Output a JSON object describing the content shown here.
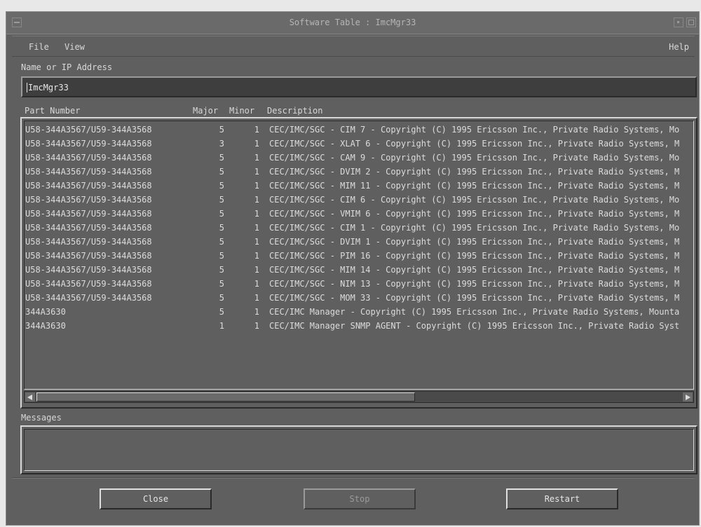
{
  "window": {
    "title": "Software Table : ImcMgr33"
  },
  "menubar": {
    "file": "File",
    "view": "View",
    "help": "Help"
  },
  "name_field": {
    "label": "Name or IP Address",
    "value": "ImcMgr33"
  },
  "table": {
    "columns": {
      "part": "Part Number",
      "major": "Major",
      "minor": "Minor",
      "description": "Description"
    },
    "rows": [
      {
        "part": "U58-344A3567/U59-344A3568",
        "major": "5",
        "minor": "1",
        "description": "CEC/IMC/SGC - CIM 7 - Copyright (C) 1995 Ericsson Inc., Private Radio Systems, Mo"
      },
      {
        "part": "U58-344A3567/U59-344A3568",
        "major": "3",
        "minor": "1",
        "description": "CEC/IMC/SGC - XLAT 6 - Copyright (C) 1995 Ericsson Inc., Private Radio Systems, M"
      },
      {
        "part": "U58-344A3567/U59-344A3568",
        "major": "5",
        "minor": "1",
        "description": "CEC/IMC/SGC - CAM 9 - Copyright (C) 1995 Ericsson Inc., Private Radio Systems, Mo"
      },
      {
        "part": "U58-344A3567/U59-344A3568",
        "major": "5",
        "minor": "1",
        "description": "CEC/IMC/SGC - DVIM 2 - Copyright (C) 1995 Ericsson Inc., Private Radio Systems, M"
      },
      {
        "part": "U58-344A3567/U59-344A3568",
        "major": "5",
        "minor": "1",
        "description": "CEC/IMC/SGC - MIM 11 - Copyright (C) 1995 Ericsson Inc., Private Radio Systems, M"
      },
      {
        "part": "U58-344A3567/U59-344A3568",
        "major": "5",
        "minor": "1",
        "description": "CEC/IMC/SGC - CIM 6 - Copyright (C) 1995 Ericsson Inc., Private Radio Systems, Mo"
      },
      {
        "part": "U58-344A3567/U59-344A3568",
        "major": "5",
        "minor": "1",
        "description": "CEC/IMC/SGC - VMIM 6 - Copyright (C) 1995 Ericsson Inc., Private Radio Systems, M"
      },
      {
        "part": "U58-344A3567/U59-344A3568",
        "major": "5",
        "minor": "1",
        "description": "CEC/IMC/SGC - CIM 1 - Copyright (C) 1995 Ericsson Inc., Private Radio Systems, Mo"
      },
      {
        "part": "U58-344A3567/U59-344A3568",
        "major": "5",
        "minor": "1",
        "description": "CEC/IMC/SGC - DVIM 1 - Copyright (C) 1995 Ericsson Inc., Private Radio Systems, M"
      },
      {
        "part": "U58-344A3567/U59-344A3568",
        "major": "5",
        "minor": "1",
        "description": "CEC/IMC/SGC - PIM 16 - Copyright (C) 1995 Ericsson Inc., Private Radio Systems, M"
      },
      {
        "part": "U58-344A3567/U59-344A3568",
        "major": "5",
        "minor": "1",
        "description": "CEC/IMC/SGC - MIM 14 - Copyright (C) 1995 Ericsson Inc., Private Radio Systems, M"
      },
      {
        "part": "U58-344A3567/U59-344A3568",
        "major": "5",
        "minor": "1",
        "description": "CEC/IMC/SGC - NIM 13 - Copyright (C) 1995 Ericsson Inc., Private Radio Systems, M"
      },
      {
        "part": "U58-344A3567/U59-344A3568",
        "major": "5",
        "minor": "1",
        "description": "CEC/IMC/SGC - MOM 33 - Copyright (C) 1995 Ericsson Inc., Private Radio Systems, M"
      },
      {
        "part": "344A3630",
        "major": "5",
        "minor": "1",
        "description": "CEC/IMC Manager - Copyright (C) 1995 Ericsson Inc., Private Radio Systems, Mounta"
      },
      {
        "part": "344A3630",
        "major": "1",
        "minor": "1",
        "description": "CEC/IMC Manager SNMP AGENT - Copyright (C) 1995 Ericsson Inc., Private Radio Syst"
      }
    ]
  },
  "messages": {
    "label": "Messages",
    "text": ""
  },
  "buttons": {
    "close": "Close",
    "stop": "Stop",
    "restart": "Restart"
  }
}
